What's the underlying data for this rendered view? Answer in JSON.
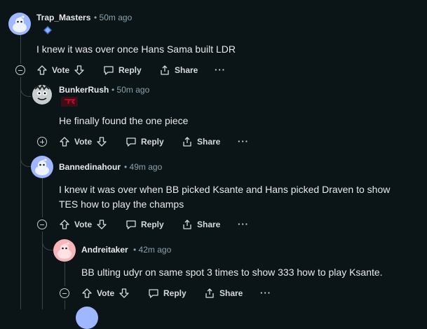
{
  "comments": [
    {
      "username": "Trap_Masters",
      "time": "50m ago",
      "body": "I knew it was over once Hans Sama built LDR",
      "collapse": "minus"
    },
    {
      "username": "BunkerRush",
      "time": "50m ago",
      "body": "He finally found the one piece",
      "collapse": "plus"
    },
    {
      "username": "Bannedinahour",
      "time": "49m ago",
      "body": "I knew it was over when BB picked Ksante and Hans picked Draven to show TES how to play the champs",
      "collapse": "minus"
    },
    {
      "username": "Andreitaker",
      "time": "42m ago",
      "body": "BB ulting udyr on same spot 3 times to show 333 how to play Ksante.",
      "collapse": "minus"
    }
  ],
  "actions": {
    "vote": "Vote",
    "reply": "Reply",
    "share": "Share",
    "more": "···"
  },
  "colors": {
    "background": "#0b1416",
    "text": "#e8eaeb",
    "meta": "#8ba2ad",
    "thread": "#3a4548"
  }
}
